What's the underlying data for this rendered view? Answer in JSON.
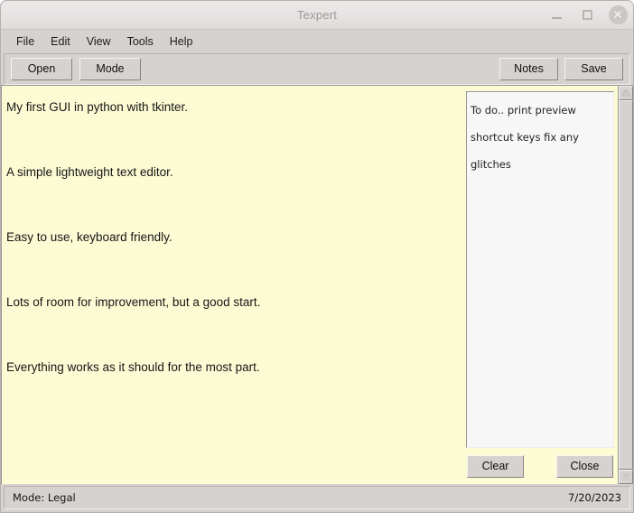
{
  "window": {
    "title": "Texpert",
    "controls": {
      "minimize": "minimize-icon",
      "maximize": "maximize-icon",
      "close": "✕"
    }
  },
  "menubar": {
    "items": [
      {
        "label": "File"
      },
      {
        "label": "Edit"
      },
      {
        "label": "View"
      },
      {
        "label": "Tools"
      },
      {
        "label": "Help"
      }
    ]
  },
  "toolbar": {
    "open_label": "Open",
    "mode_label": "Mode",
    "notes_label": "Notes",
    "save_label": "Save"
  },
  "editor": {
    "content": "My first GUI in python with tkinter.\n\nA simple lightweight text editor.\n\nEasy to use, keyboard friendly.\n\nLots of room for improvement, but a good start.\n\nEverything works as it should for the most part.",
    "background_color": "#fdfbd4"
  },
  "notes": {
    "content": "To do..\n\nprint preview\n\nshortcut keys\n\nfix any glitches",
    "clear_label": "Clear",
    "close_label": "Close",
    "background_color": "#f7f7f7"
  },
  "scrollbar": {
    "up_arrow": "scroll-up-icon",
    "down_arrow": "scroll-down-icon"
  },
  "statusbar": {
    "mode": "Mode: Legal",
    "date": "7/20/2023"
  }
}
